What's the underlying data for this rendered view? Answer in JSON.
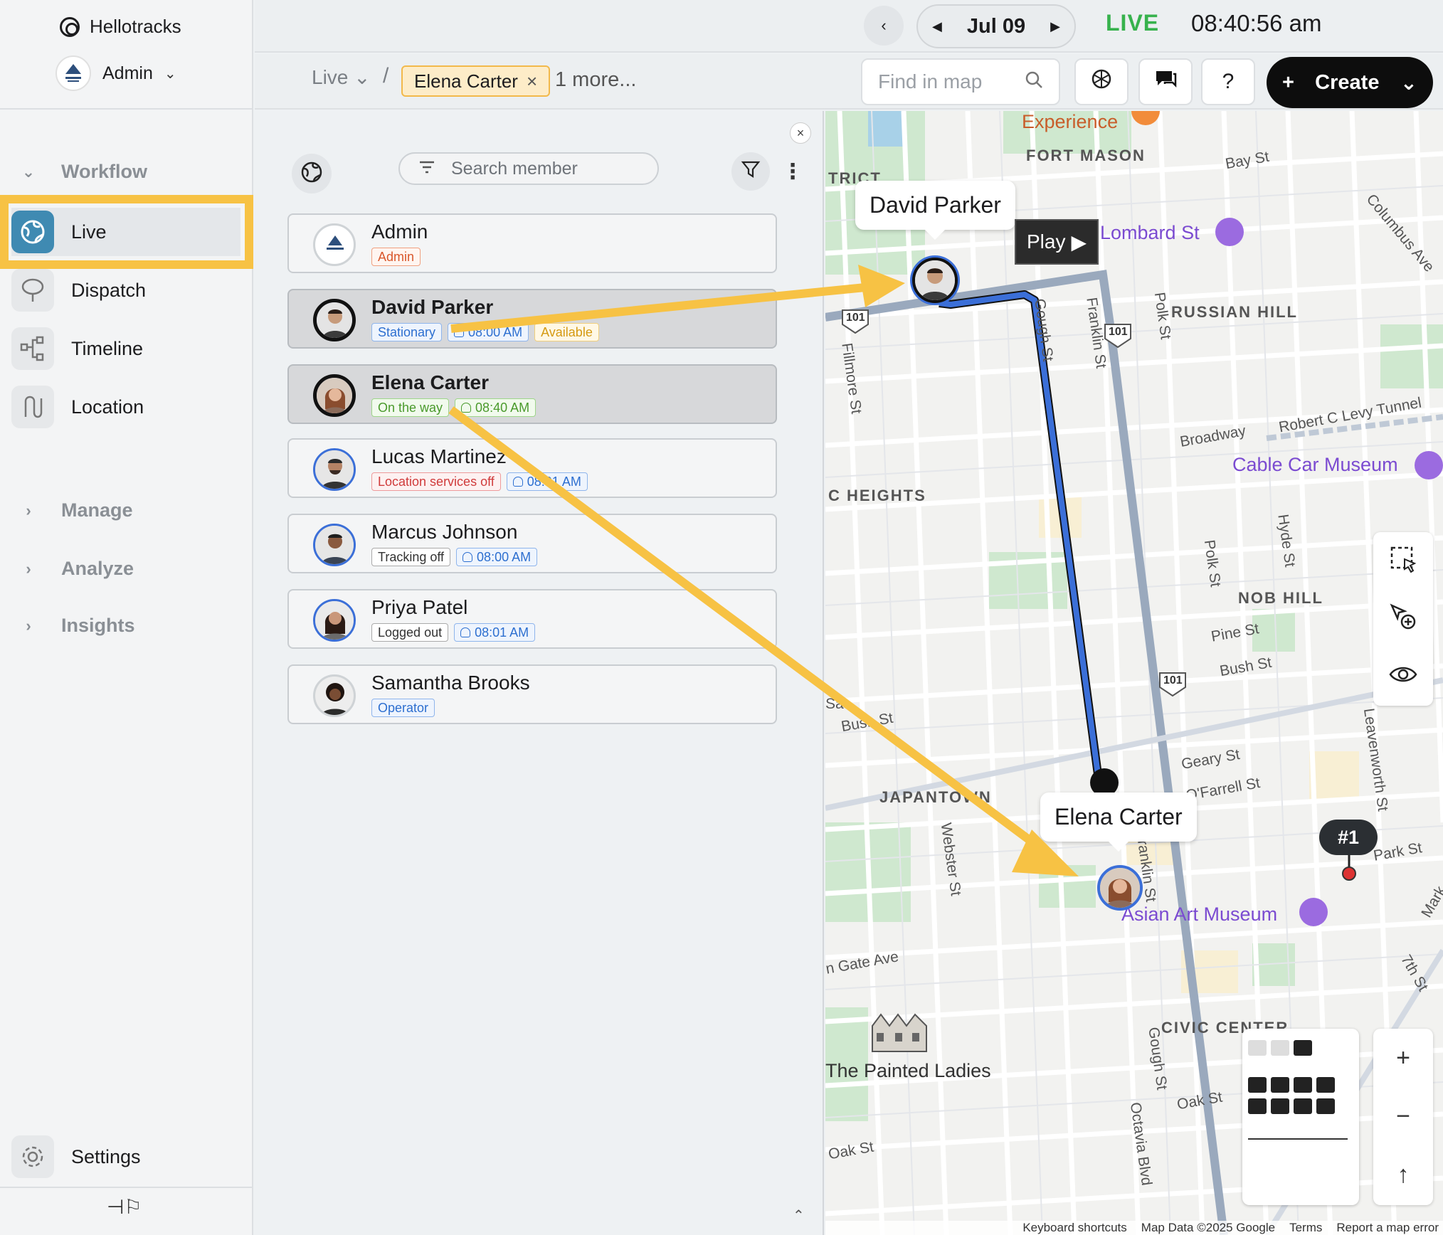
{
  "app": {
    "brand": "Hellotracks",
    "account_name": "Admin"
  },
  "sidebar": {
    "workflow_label": "Workflow",
    "items": [
      {
        "label": "Live"
      },
      {
        "label": "Dispatch"
      },
      {
        "label": "Timeline"
      },
      {
        "label": "Location"
      }
    ],
    "manage_label": "Manage",
    "analyze_label": "Analyze",
    "insights_label": "Insights",
    "settings_label": "Settings"
  },
  "topbar": {
    "date": "Jul 09",
    "live_label": "LIVE",
    "time": "08:40:56 am"
  },
  "subbar": {
    "crumb_live": "Live",
    "crumb_sep": "/",
    "chip_label": "Elena Carter",
    "more_label": "1 more...",
    "find_placeholder": "Find in map",
    "help_label": "?",
    "create_label": "Create"
  },
  "panel": {
    "search_placeholder": "Search member",
    "members": [
      {
        "name": "Admin",
        "tags": [
          {
            "text": "Admin",
            "style": "orange"
          }
        ]
      },
      {
        "name": "David Parker",
        "tags": [
          {
            "text": "Stationary",
            "style": "blue"
          },
          {
            "text": "08:00 AM",
            "style": "blue",
            "icon": true
          },
          {
            "text": "Available",
            "style": "yellow"
          }
        ]
      },
      {
        "name": "Elena Carter",
        "tags": [
          {
            "text": "On the way",
            "style": "green"
          },
          {
            "text": "08:40 AM",
            "style": "green",
            "icon": true
          }
        ]
      },
      {
        "name": "Lucas Martinez",
        "tags": [
          {
            "text": "Location services off",
            "style": "red"
          },
          {
            "text": "08:01 AM",
            "style": "blue",
            "icon": true
          }
        ]
      },
      {
        "name": "Marcus Johnson",
        "tags": [
          {
            "text": "Tracking off",
            "style": "dark"
          },
          {
            "text": "08:00 AM",
            "style": "blue",
            "icon": true
          }
        ]
      },
      {
        "name": "Priya Patel",
        "tags": [
          {
            "text": "Logged out",
            "style": "dark"
          },
          {
            "text": "08:01 AM",
            "style": "blue",
            "icon": true
          }
        ]
      },
      {
        "name": "Samantha Brooks",
        "tags": [
          {
            "text": "Operator",
            "style": "blue"
          }
        ]
      }
    ]
  },
  "map": {
    "tooltip_david": "David Parker",
    "tooltip_elena": "Elena Carter",
    "play_label": "Play",
    "pin_label": "#1",
    "neighborhoods": {
      "fort_mason": "FORT MASON",
      "russian_hill": "RUSSIAN HILL",
      "heights": "C HEIGHTS",
      "nob_hill": "NOB HILL",
      "japantown": "JAPANTOWN",
      "civic_center": "CIVIC CENTER",
      "trict": "TRICT"
    },
    "pois": {
      "experience": "Experience",
      "lombard": "Lombard St",
      "cable_car": "Cable Car Museum",
      "asian_art": "Asian Art Museum",
      "painted_ladies": "The Painted Ladies"
    },
    "streets": {
      "bay": "Bay St",
      "columbus": "Columbus Ave",
      "polk1": "Polk St",
      "franklin1": "Franklin St",
      "gough1": "Gough St",
      "fillmore": "Fillmore St",
      "broadway": "Broadway",
      "levy": "Robert C Levy Tunnel",
      "hyde": "Hyde St",
      "polk2": "Polk St",
      "pine": "Pine St",
      "bush1": "Bush St",
      "bush2": "Bush St",
      "geary": "Geary St",
      "ofarrell": "O'Farrell St",
      "leavenworth": "Leavenworth St",
      "park": "Park St",
      "webster": "Webster St",
      "franklin2": "Franklin St",
      "golden_gate": "n Gate Ave",
      "gough2": "Gough St",
      "oak1": "Oak St",
      "oak2": "Oak St",
      "octavia": "Octavia Blvd",
      "seventh": "7th St",
      "mark": "Mark",
      "sac": "Sa"
    },
    "highways": [
      "101",
      "101",
      "101"
    ],
    "attribution": [
      "Keyboard shortcuts",
      "Map Data ©2025 Google",
      "Terms",
      "Report a map error"
    ]
  },
  "colors": {
    "accent_highlight": "#f7c244",
    "route_blue": "#3b6fd8",
    "live_green": "#37b24d"
  }
}
